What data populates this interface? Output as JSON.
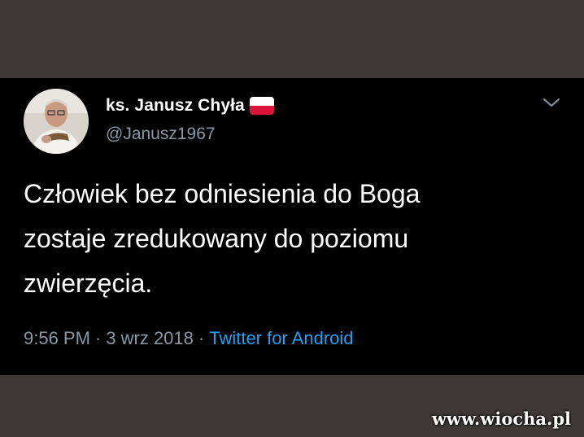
{
  "tweet": {
    "display_name": "ks. Janusz Chyła",
    "flag_icon": "poland-flag-icon",
    "handle": "@Janusz1967",
    "text": "Człowiek bez odniesienia do Boga\nzostaje zredukowany do poziomu\nzwierzęcia.",
    "time": "9:56 PM",
    "date": "3 wrz 2018",
    "separator": "·",
    "source": "Twitter for Android"
  },
  "watermark": "www.wiocha.pl",
  "colors": {
    "background": "#3e3837",
    "card": "#000000",
    "text": "#ffffff",
    "muted": "#8899a6",
    "link": "#1da1f2",
    "flag_red": "#dc143c"
  }
}
